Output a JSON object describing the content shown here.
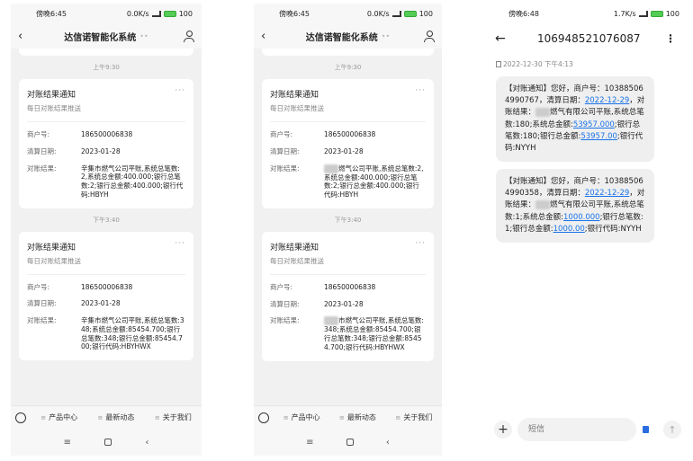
{
  "phones": [
    {
      "status": {
        "time": "傍晚6:45",
        "speed": "0.0K/s",
        "battery": "100"
      },
      "header": {
        "title": "达信诺智能化系统"
      },
      "messages": [
        {
          "time": "上午9:30",
          "title": "对账结果通知",
          "subtitle": "每日对账结果推送",
          "merchant_label": "商户号:",
          "merchant": "186500006838",
          "date_label": "清算日期:",
          "date": "2023-01-28",
          "result_label": "对账结果:",
          "result": "辛集市燃气公司平账,系统总笔数:2,系统总金额:400.000;银行总笔数:2;银行总金额:400.000;银行代码:HBYH"
        },
        {
          "time": "下午3:40",
          "title": "对账结果通知",
          "subtitle": "每日对账结果推送",
          "merchant_label": "商户号:",
          "merchant": "186500006838",
          "date_label": "清算日期:",
          "date": "2023-01-28",
          "result_label": "对账结果:",
          "result": "辛集市燃气公司平账,系统总笔数:348;系统总金额:85454.700;银行总笔数:348;银行总金额:85454.700;银行代码:HBYHWX"
        }
      ],
      "tabbar": [
        "产品中心",
        "最新动态",
        "关于我们"
      ]
    },
    {
      "status": {
        "time": "傍晚6:45",
        "speed": "0.0K/s",
        "battery": "100"
      },
      "header": {
        "title": "达信诺智能化系统"
      },
      "messages": [
        {
          "time": "上午9:30",
          "title": "对账结果通知",
          "subtitle": "每日对账结果推送",
          "merchant_label": "商户号:",
          "merchant": "186500006838",
          "date_label": "清算日期:",
          "date": "2023-01-28",
          "result_label": "对账结果:",
          "result_prefix": "",
          "result": "燃气公司平账,系统总笔数:2,系统总金额:400.000;银行总笔数:2;银行总金额:400.000;银行代码:HBYH"
        },
        {
          "time": "下午3:40",
          "title": "对账结果通知",
          "subtitle": "每日对账结果推送",
          "merchant_label": "商户号:",
          "merchant": "186500006838",
          "date_label": "清算日期:",
          "date": "2023-01-28",
          "result_label": "对账结果:",
          "result": "市燃气公司平账,系统总笔数:348;系统总金额:85454.700;银行总笔数:348;银行总金额:85454.700;银行代码:HBYHWX"
        }
      ],
      "tabbar": [
        "产品中心",
        "最新动态",
        "关于我们"
      ]
    }
  ],
  "sms": {
    "status": {
      "time": "傍晚6:48",
      "speed": "1.7K/s",
      "battery": "100"
    },
    "number": "106948521076087",
    "timestamp": "2022-12-30 下午4:13",
    "messages": [
      {
        "head": "【对账通知】您好，商户号：103885064990767，清算日期：",
        "date": "2022-12-29",
        "mid1": "，对账结果：",
        "mid2": "燃气有限公司平账,系统总笔数:180;系统总金额:",
        "amount1": "53957.000",
        "mid3": ";银行总笔数:180;银行总金额:",
        "amount2": "53957.00",
        "tail": ";银行代码:NYYH"
      },
      {
        "head": "【对账通知】您好，商户号：103885064990358，清算日期：",
        "date": "2022-12-29",
        "mid1": "，对账结果：",
        "mid2": "燃气有限公司平账,系统总笔数:1;系统总金额:",
        "amount1": "1000.000",
        "mid3": ";银行总笔数:1;银行总金额:",
        "amount2": "1000.00",
        "tail": ";银行代码:NYYH"
      }
    ],
    "input_placeholder": "短信"
  },
  "colors": {
    "link": "#1a73e8",
    "bg_phone": "#f1f1f1",
    "bubble": "#efefef"
  }
}
